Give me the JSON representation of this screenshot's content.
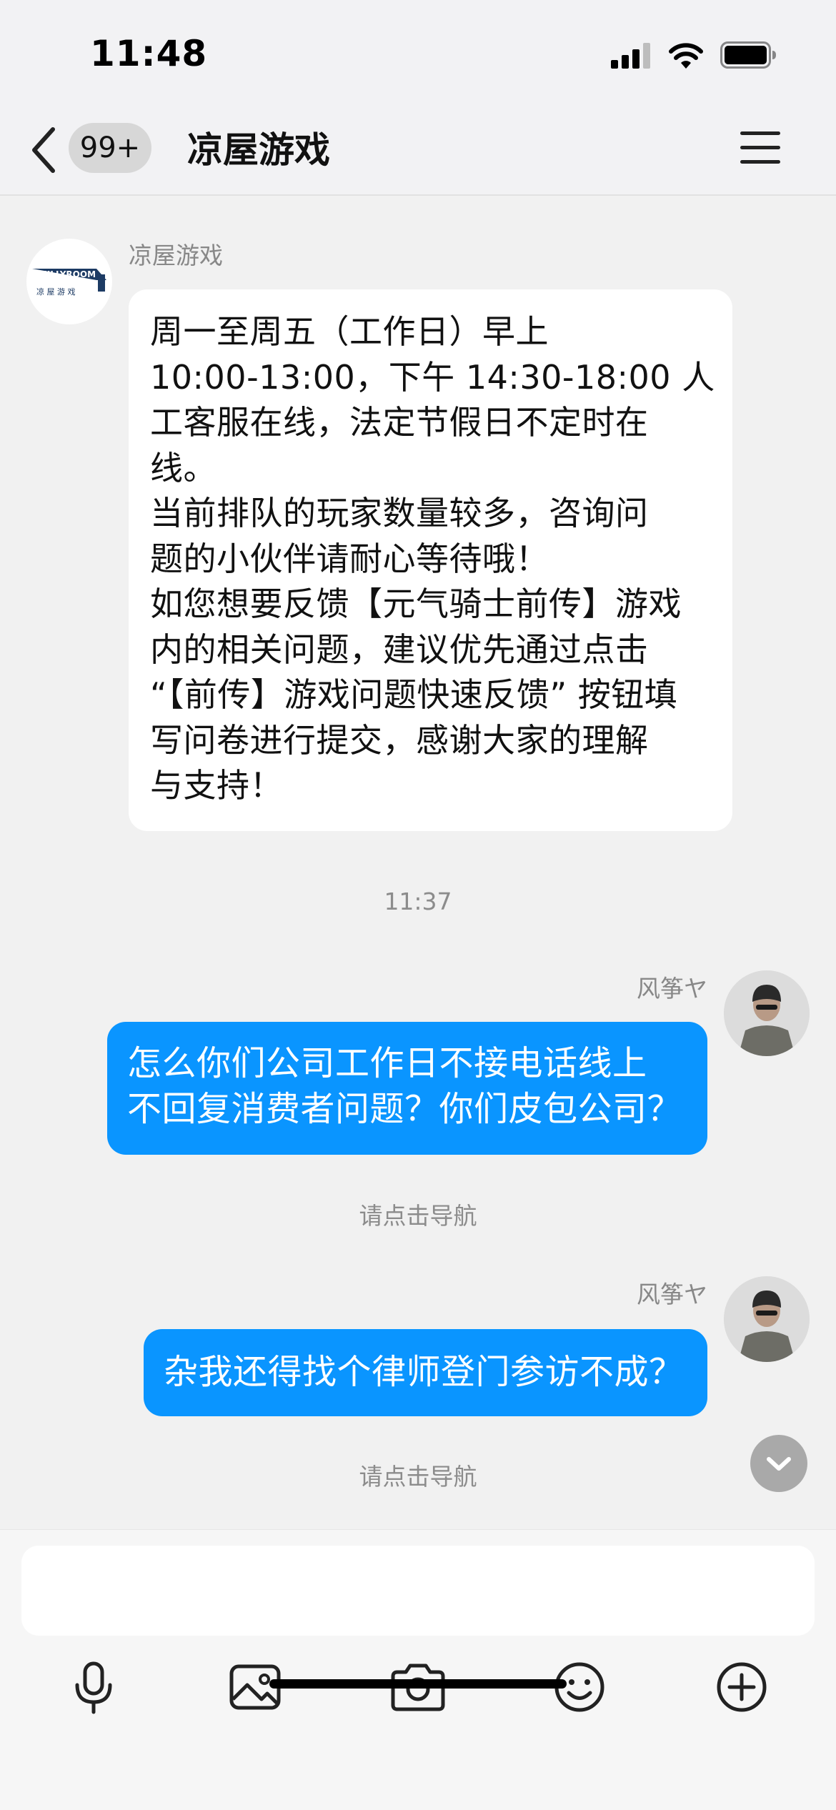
{
  "status_bar": {
    "time": "11:48"
  },
  "nav": {
    "unread_count": "99+",
    "title": "凉屋游戏"
  },
  "messages": [
    {
      "sender": "凉屋游戏",
      "avatar_text": [
        "CHILLYROOM",
        "凉 屋 游 戏"
      ],
      "lines": [
        "周一至周五（工作日）早上",
        "10:00-13:00，下午 14:30-18:00 人",
        "工客服在线，法定节假日不定时在",
        "线。",
        "当前排队的玩家数量较多，咨询问",
        "题的小伙伴请耐心等待哦！",
        "如您想要反馈【元气骑士前传】游戏",
        "内的相关问题，建议优先通过点击",
        "“【前传】游戏问题快速反馈” 按钮填",
        "写问卷进行提交，感谢大家的理解",
        "与支持！"
      ]
    },
    {
      "timestamp": "11:37"
    },
    {
      "sender": "风筝ヤ",
      "lines": [
        "怎么你们公司工作日不接电话线上",
        "不回复消费者问题？你们皮包公司？"
      ]
    },
    {
      "system": "请点击导航"
    },
    {
      "sender": "风筝ヤ",
      "lines": [
        "杂我还得找个律师登门参访不成？"
      ]
    },
    {
      "system": "请点击导航"
    }
  ],
  "input": {
    "placeholder": ""
  },
  "toolbar": [
    "microphone-icon",
    "image-icon",
    "camera-icon",
    "emoji-icon",
    "plus-icon"
  ],
  "colors": {
    "accent": "#0a95ff",
    "background": "#f1f1f1",
    "bubble_in": "#ffffff"
  }
}
